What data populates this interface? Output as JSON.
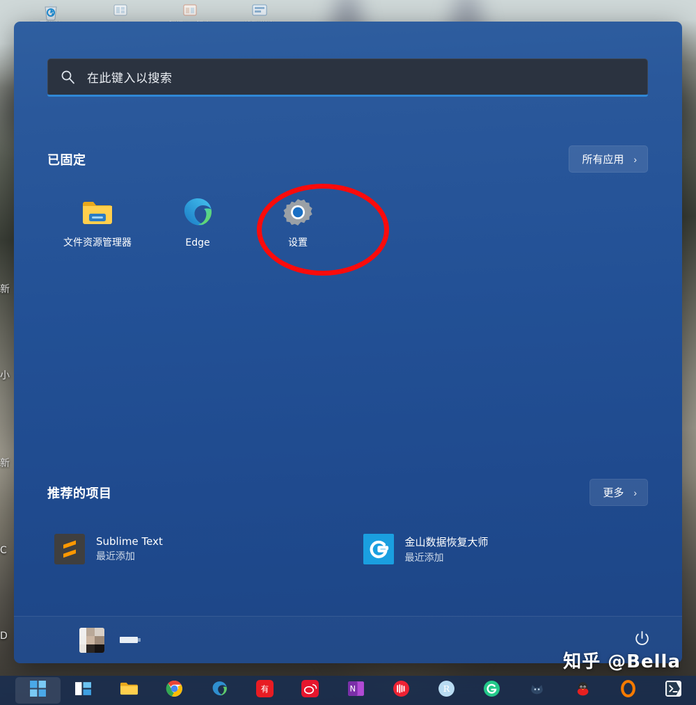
{
  "watermark": "知乎 @Bella",
  "start_menu": {
    "search": {
      "placeholder": "在此键入以搜索",
      "icon": "search-icon",
      "value": ""
    },
    "pinned": {
      "title": "已固定",
      "all_apps_label": "所有应用",
      "all_apps_chevron": "›",
      "apps": [
        {
          "label": "文件资源管理器",
          "icon": "file-explorer-icon"
        },
        {
          "label": "Edge",
          "icon": "edge-icon"
        },
        {
          "label": "设置",
          "icon": "settings-gear-icon"
        }
      ]
    },
    "recommended": {
      "title": "推荐的项目",
      "more_label": "更多",
      "more_chevron": "›",
      "items": [
        {
          "name": "Sublime Text",
          "subtitle": "最近添加",
          "icon": "sublime-text-icon"
        },
        {
          "name": "金山数据恢复大师",
          "subtitle": "最近添加",
          "icon": "kingsoft-recovery-icon"
        }
      ]
    },
    "user_bar": {
      "avatar": "user-avatar-redacted",
      "username": "",
      "power_label": "power-icon"
    }
  },
  "annotation": {
    "shape": "ellipse",
    "color": "#fb0b0b",
    "targets": "设置"
  },
  "desktop": {
    "top_icons": [
      {
        "label": "回收站",
        "icon": "recycle-bin-icon"
      },
      {
        "label": "QQ",
        "icon": "qq-icon"
      },
      {
        "label": "腾讯QQ管家",
        "icon": "qq-manager-icon"
      },
      {
        "label": "搜狗拼音",
        "icon": "sogou-icon"
      }
    ],
    "left_fragments": [
      "新",
      "小",
      "新",
      "C",
      "D"
    ]
  },
  "taskbar": {
    "items": [
      {
        "name": "start-button",
        "icon": "windows-logo-icon",
        "active": true
      },
      {
        "name": "task-view-button",
        "icon": "task-view-icon",
        "active": false
      },
      {
        "name": "file-explorer-button",
        "icon": "folder-icon",
        "active": false
      },
      {
        "name": "chrome-button",
        "icon": "chrome-icon",
        "active": false
      },
      {
        "name": "edge-button",
        "icon": "edge-icon",
        "active": false
      },
      {
        "name": "youdao-button",
        "icon": "youdao-icon",
        "active": false,
        "text": "有道"
      },
      {
        "name": "weibo-button",
        "icon": "weibo-icon",
        "active": false
      },
      {
        "name": "onenote-button",
        "icon": "onenote-icon",
        "active": false,
        "text": "N"
      },
      {
        "name": "recorder-button",
        "icon": "red-record-icon",
        "active": false
      },
      {
        "name": "rstudio-button",
        "icon": "rstudio-icon",
        "active": false,
        "text": "R"
      },
      {
        "name": "kingsoft-button",
        "icon": "kingsoft-g-icon",
        "active": false,
        "text": "G"
      },
      {
        "name": "cat-app-button",
        "icon": "cat-icon",
        "active": false
      },
      {
        "name": "qq-button",
        "icon": "qq-penguin-icon",
        "active": false
      },
      {
        "name": "opera-button",
        "icon": "opera-o-icon",
        "active": false
      },
      {
        "name": "terminal-button",
        "icon": "terminal-icon",
        "active": false
      }
    ]
  },
  "colors": {
    "panel_blue": "#235196",
    "search_bg": "#2b3340",
    "search_accent": "#2f88d6",
    "annotation_red": "#fb0b0b",
    "taskbar_bg": "#162d52"
  }
}
